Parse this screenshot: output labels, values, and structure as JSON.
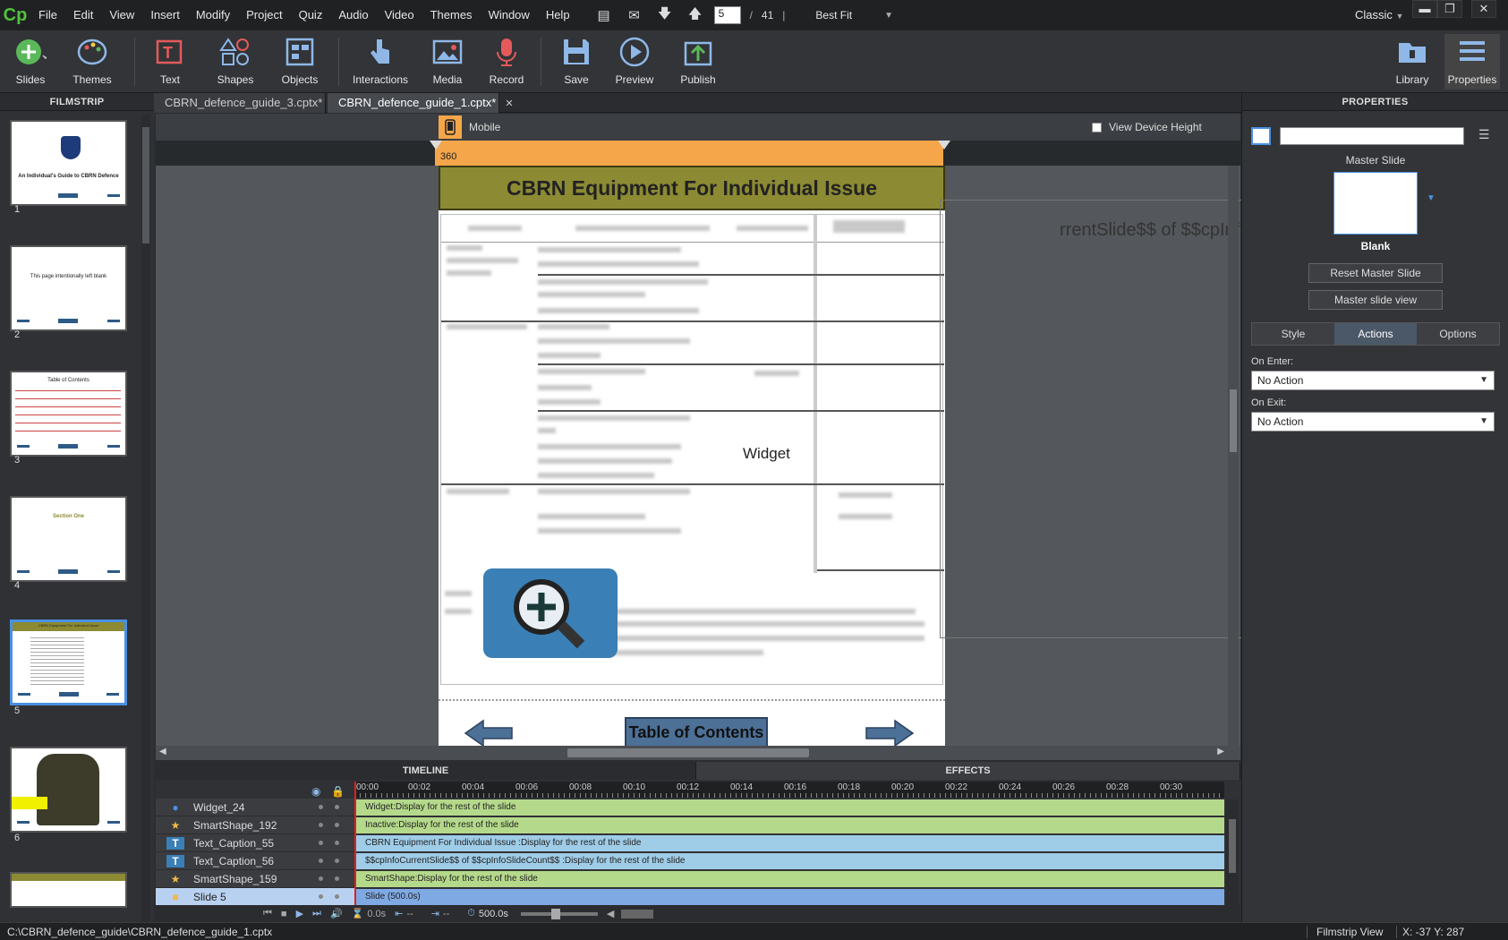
{
  "app": {
    "logo": "Cp",
    "workspace": "Classic"
  },
  "menu": [
    "File",
    "Edit",
    "View",
    "Insert",
    "Modify",
    "Project",
    "Quiz",
    "Audio",
    "Video",
    "Themes",
    "Window",
    "Help"
  ],
  "nav": {
    "current_slide": "5",
    "separator": "/",
    "total": "41",
    "zoom": "Best Fit"
  },
  "toolbar": {
    "slides": "Slides",
    "themes": "Themes",
    "text": "Text",
    "shapes": "Shapes",
    "objects": "Objects",
    "interactions": "Interactions",
    "media": "Media",
    "record": "Record",
    "save": "Save",
    "preview": "Preview",
    "publish": "Publish",
    "library": "Library",
    "properties": "Properties"
  },
  "filmstrip": {
    "title": "FILMSTRIP",
    "thumbs": [
      {
        "num": "1",
        "title": "An Individual's Guide to CBRN Defence"
      },
      {
        "num": "2",
        "title": "This page intentionally left blank"
      },
      {
        "num": "3",
        "title": "Table of Contents"
      },
      {
        "num": "4",
        "title": "Section One"
      },
      {
        "num": "5",
        "title": "CBRN Equipment For Individual Issue"
      },
      {
        "num": "6",
        "title": ""
      }
    ]
  },
  "tabs": [
    {
      "label": "CBRN_defence_guide_3.cptx*"
    },
    {
      "label": "CBRN_defence_guide_1.cptx*"
    }
  ],
  "stage": {
    "device": "Mobile",
    "view_device_height": "View Device Height",
    "ruler_width": "360",
    "slide_title": "CBRN Equipment For Individual Issue",
    "widget_label": "Widget",
    "var_text": "rrentSlide$$ of $$cpInfoSlideCo",
    "toc_button": "Table of Contents"
  },
  "timeline": {
    "heads": {
      "timeline": "TIMELINE",
      "effects": "EFFECTS"
    },
    "ticks": [
      "00:00",
      "00:02",
      "00:04",
      "00:06",
      "00:08",
      "00:10",
      "00:12",
      "00:14",
      "00:16",
      "00:18",
      "00:20",
      "00:22",
      "00:24",
      "00:26",
      "00:28",
      "00:30"
    ],
    "rows": [
      {
        "name": "Widget_24",
        "bar": "Widget:Display for the rest of the slide",
        "icon": "●"
      },
      {
        "name": "SmartShape_192",
        "bar": "Inactive:Display for the rest of the slide",
        "icon": "★"
      },
      {
        "name": "Text_Caption_55",
        "bar": "CBRN Equipment For Individual Issue :Display for the rest of the slide",
        "icon": "T"
      },
      {
        "name": "Text_Caption_56",
        "bar": "$$cpInfoCurrentSlide$$ of $$cpInfoSlideCount$$ :Display for the rest of the slide",
        "icon": "T"
      },
      {
        "name": "SmartShape_159",
        "bar": "SmartShape:Display for the rest of the slide",
        "icon": "★"
      },
      {
        "name": "Slide 5",
        "bar": "Slide (500.0s)",
        "icon": "■"
      }
    ],
    "controls": {
      "time": "0.0s",
      "start": "--",
      "end": "--",
      "duration": "500.0s"
    }
  },
  "properties": {
    "title": "PROPERTIES",
    "master_slide_label": "Master Slide",
    "master_name": "Blank",
    "reset_btn": "Reset Master Slide",
    "view_btn": "Master slide view",
    "tabs": [
      "Style",
      "Actions",
      "Options"
    ],
    "on_enter_label": "On Enter:",
    "on_enter": "No Action",
    "on_exit_label": "On Exit:",
    "on_exit": "No Action"
  },
  "status": {
    "path": "C:\\CBRN_defence_guide\\CBRN_defence_guide_1.cptx",
    "view": "Filmstrip View",
    "coords": "X: -37 Y: 287"
  }
}
